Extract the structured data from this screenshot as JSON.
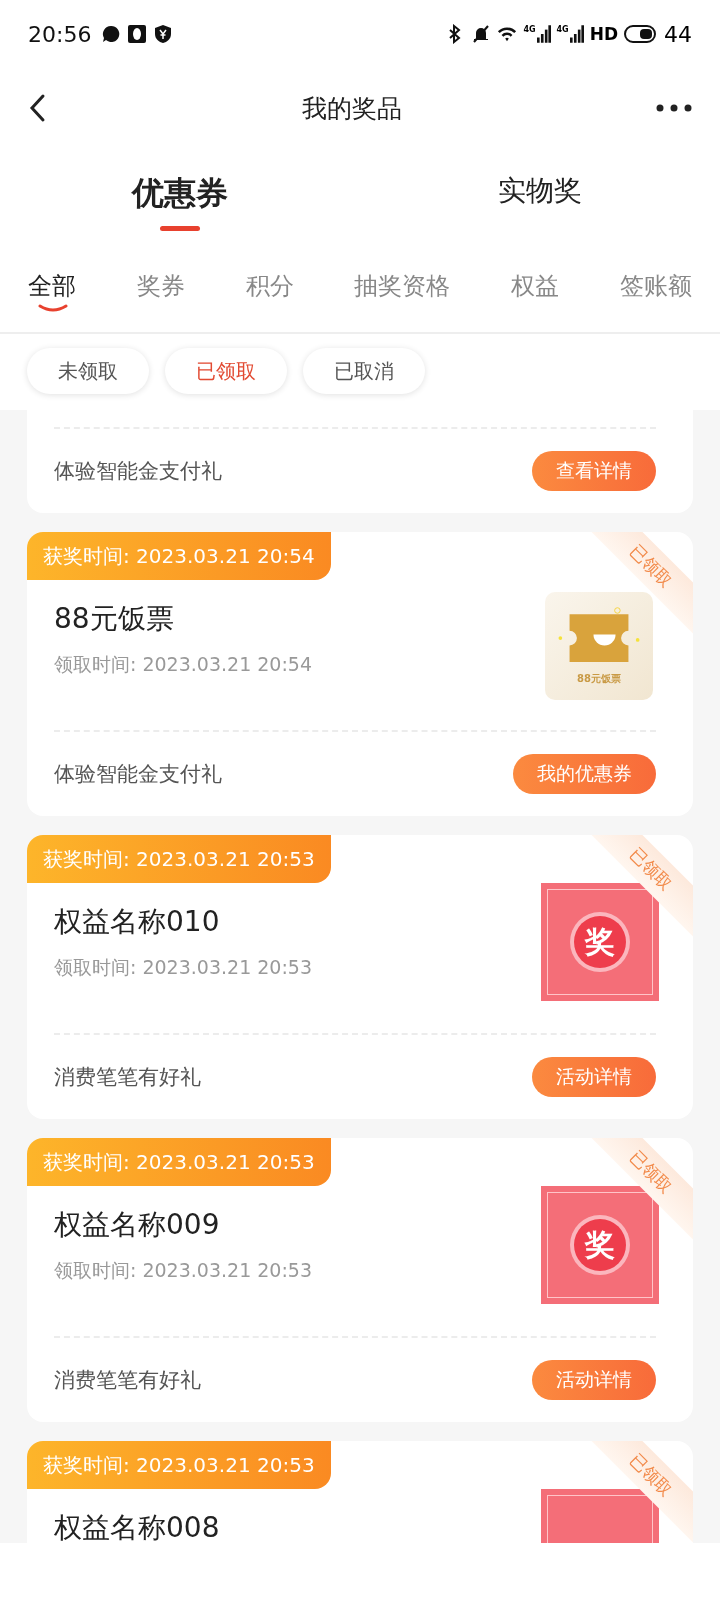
{
  "status_bar": {
    "time": "20:56",
    "network_labels": [
      "4G",
      "4G"
    ],
    "hd": "HD",
    "battery": "44"
  },
  "header": {
    "title": "我的奖品"
  },
  "main_tabs": [
    {
      "label": "优惠券",
      "selected": true
    },
    {
      "label": "实物奖",
      "selected": false
    }
  ],
  "sub_tabs": [
    {
      "label": "全部",
      "selected": true
    },
    {
      "label": "奖券",
      "selected": false
    },
    {
      "label": "积分",
      "selected": false
    },
    {
      "label": "抽奖资格",
      "selected": false
    },
    {
      "label": "权益",
      "selected": false
    },
    {
      "label": "签账额",
      "selected": false
    }
  ],
  "filters": [
    {
      "label": "未领取",
      "selected": false
    },
    {
      "label": "已领取",
      "selected": true
    },
    {
      "label": "已取消",
      "selected": false
    }
  ],
  "cards": [
    {
      "kind": "partial",
      "footer_text": "体验智能金支付礼",
      "button": "查看详情"
    },
    {
      "kind": "full",
      "time_badge": "获奖时间: 2023.03.21 20:54",
      "stamp": "已领取",
      "title": "88元饭票",
      "claim_time": "领取时间: 2023.03.21 20:54",
      "image": {
        "kind": "meal_ticket",
        "label": "88元饭票"
      },
      "footer_text": "体验智能金支付礼",
      "button": "我的优惠券"
    },
    {
      "kind": "full",
      "time_badge": "获奖时间: 2023.03.21 20:53",
      "stamp": "已领取",
      "title": "权益名称010",
      "claim_time": "领取时间: 2023.03.21 20:53",
      "image": {
        "kind": "prize",
        "label": "奖"
      },
      "footer_text": "消费笔笔有好礼",
      "button": "活动详情"
    },
    {
      "kind": "full",
      "time_badge": "获奖时间: 2023.03.21 20:53",
      "stamp": "已领取",
      "title": "权益名称009",
      "claim_time": "领取时间: 2023.03.21 20:53",
      "image": {
        "kind": "prize",
        "label": "奖"
      },
      "footer_text": "消费笔笔有好礼",
      "button": "活动详情"
    },
    {
      "kind": "full",
      "time_badge": "获奖时间: 2023.03.21 20:53",
      "stamp": "已领取",
      "title": "权益名称008",
      "image": {
        "kind": "prize_cut"
      }
    }
  ]
}
